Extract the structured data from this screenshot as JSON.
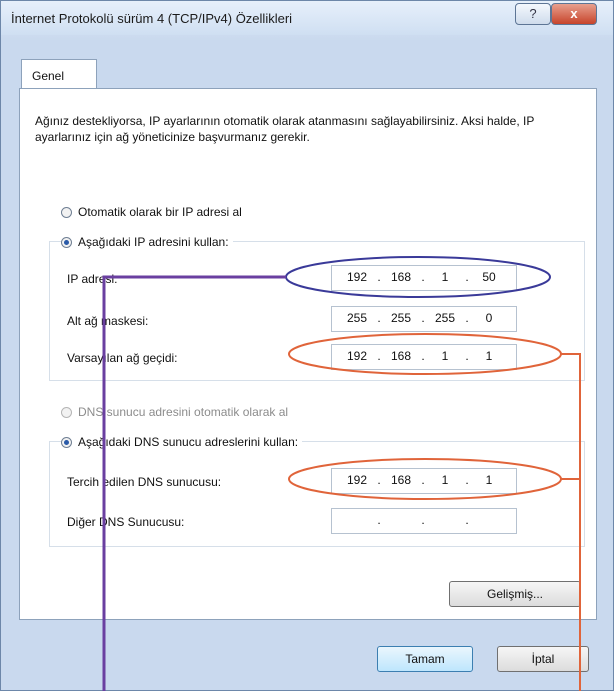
{
  "window": {
    "title": "İnternet Protokolü sürüm 4 (TCP/IPv4) Özellikleri",
    "help_label": "?",
    "close_label": "x"
  },
  "tabs": [
    {
      "label": "Genel"
    }
  ],
  "intro": "Ağınız destekliyorsa, IP ayarlarının otomatik olarak atanmasını sağlayabilirsiniz. Aksi halde, IP ayarlarınız için ağ yöneticinize başvurmanız gerekir.",
  "ip_options": {
    "auto_label": "Otomatik olarak bir IP adresi al",
    "manual_label": "Aşağıdaki IP adresini kullan:",
    "selected": "manual"
  },
  "ip_fields": [
    {
      "label": "IP adresi:",
      "octets": [
        "192",
        "168",
        "1",
        "50"
      ]
    },
    {
      "label": "Alt ağ maskesi:",
      "octets": [
        "255",
        "255",
        "255",
        "0"
      ]
    },
    {
      "label": "Varsayılan ağ geçidi:",
      "octets": [
        "192",
        "168",
        "1",
        "1"
      ]
    }
  ],
  "dns_options": {
    "auto_label": "DNS sunucu adresini otomatik olarak al",
    "manual_label": "Aşağıdaki DNS sunucu adreslerini kullan:",
    "selected": "manual"
  },
  "dns_fields": [
    {
      "label": "Tercih edilen DNS sunucusu:",
      "octets": [
        "192",
        "168",
        "1",
        "1"
      ]
    },
    {
      "label": "Diğer DNS Sunucusu:",
      "octets": [
        "",
        "",
        "",
        ""
      ]
    }
  ],
  "buttons": {
    "advanced": "Gelişmiş...",
    "ok": "Tamam",
    "cancel": "İptal"
  },
  "annotation_colors": {
    "highlight_blue": "#3a3a99",
    "highlight_orange": "#e0643a",
    "connector_purple": "#6a3fa0"
  }
}
